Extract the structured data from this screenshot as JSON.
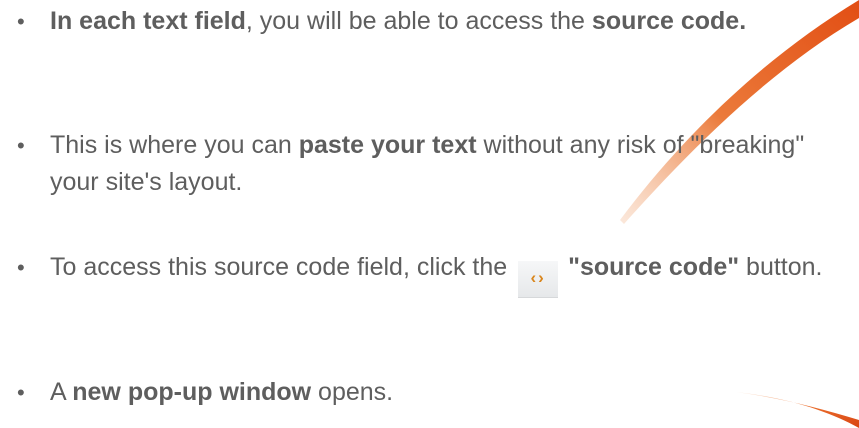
{
  "colors": {
    "text": "#5e5e5e",
    "accent": "#e65a1e"
  },
  "bullets": [
    {
      "p1": "In each text field",
      "p2": ", you will be able to access the ",
      "p3": "source code."
    },
    {
      "p1": "This is where you can ",
      "p2": "paste your text",
      "p3": " without any risk of \"breaking\" your site's layout."
    },
    {
      "p1": "To access this source code field, click the ",
      "icon": "source-code-icon",
      "icon_glyph": "‹›",
      "p2": "\"source code\"",
      "p3": " button."
    },
    {
      "p1": "A ",
      "p2": "new pop-up window",
      "p3": " opens."
    }
  ]
}
